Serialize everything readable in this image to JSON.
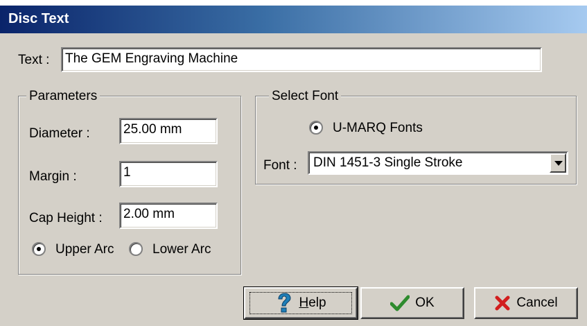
{
  "window": {
    "title": "Disc Text"
  },
  "text_field": {
    "label": "Text :",
    "value": "The GEM Engraving Machine"
  },
  "parameters": {
    "title": "Parameters",
    "diameter_label": "Diameter :",
    "diameter_value": "25.00 mm",
    "margin_label": "Margin :",
    "margin_value": "1",
    "cap_height_label": "Cap Height :",
    "cap_height_value": "2.00 mm",
    "upper_arc_label": "Upper Arc",
    "lower_arc_label": "Lower Arc",
    "selected_arc": "upper"
  },
  "select_font": {
    "title": "Select Font",
    "umarq_label": "U-MARQ Fonts",
    "font_label": "Font :",
    "font_value": "DIN 1451-3 Single Stroke"
  },
  "buttons": {
    "help_label": "Help",
    "ok_label": "OK",
    "cancel_label": "Cancel"
  },
  "colors": {
    "title_gradient_start": "#0a246a",
    "title_gradient_end": "#a6caf0",
    "dialog_face": "#d4d0c8",
    "help_icon": "#1f7fb8",
    "ok_icon": "#2e8b2e",
    "cancel_icon": "#d21e1e"
  },
  "icons": {
    "help": "question-mark-icon",
    "ok": "checkmark-icon",
    "cancel": "red-x-icon",
    "dropdown": "chevron-down-icon"
  }
}
